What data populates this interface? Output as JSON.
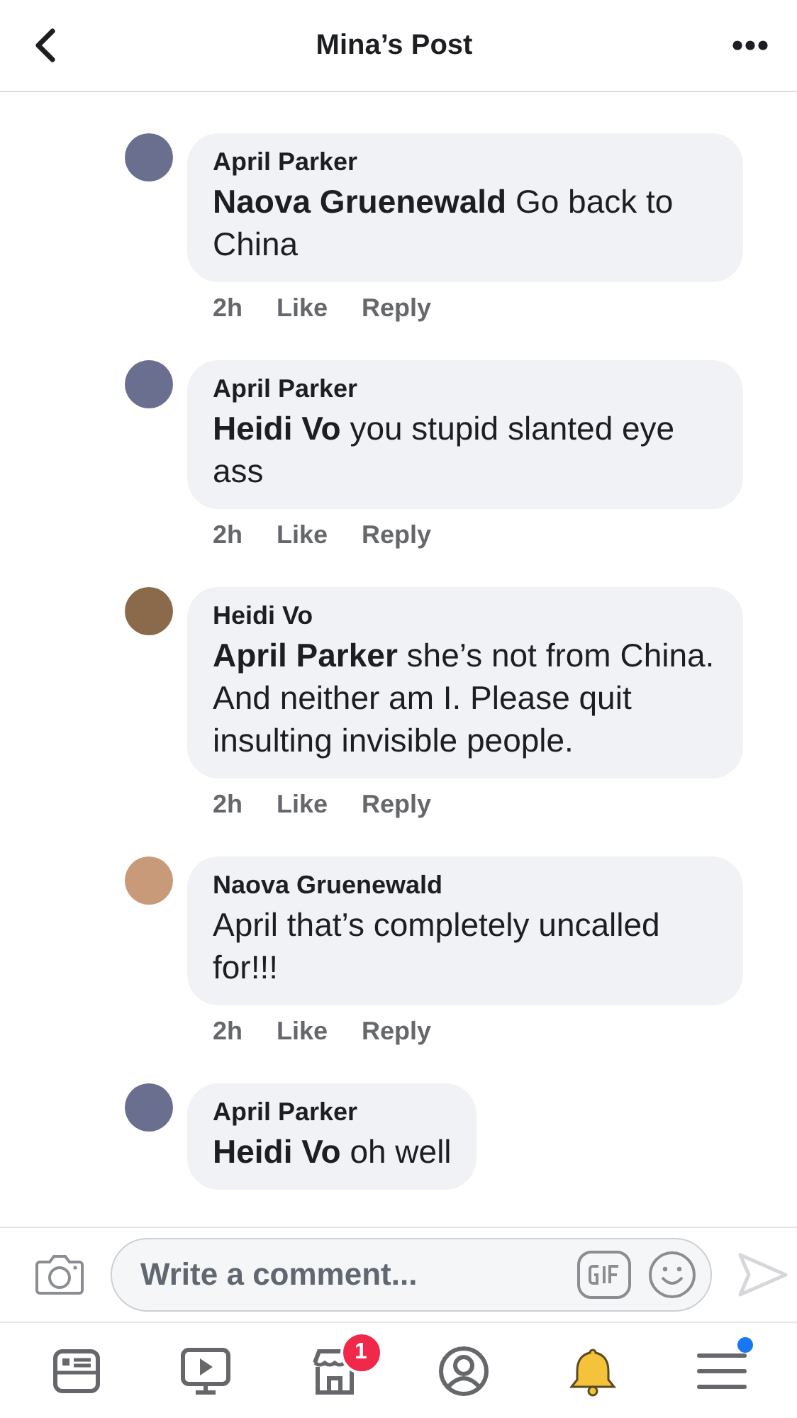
{
  "header": {
    "title": "Mina’s Post"
  },
  "comments": [
    {
      "author": "April Parker",
      "text": "**Naova Gruenewald** Go back to China",
      "time": "2h",
      "like": "Like",
      "reply": "Reply"
    },
    {
      "author": "April Parker",
      "text": "**Heidi Vo** you stupid slanted eye ass",
      "time": "2h",
      "like": "Like",
      "reply": "Reply"
    },
    {
      "author": "Heidi Vo",
      "text": "**April Parker** she’s not from China. And neither am I. Please quit insulting invisible people.",
      "time": "2h",
      "like": "Like",
      "reply": "Reply"
    },
    {
      "author": "Naova Gruenewald",
      "text": "April that’s completely uncalled for!!!",
      "time": "2h",
      "like": "Like",
      "reply": "Reply"
    },
    {
      "author": "April Parker",
      "text": "**Heidi Vo** oh well"
    }
  ],
  "composer": {
    "placeholder": "Write a comment..."
  },
  "nav": [
    {
      "kind": "feed"
    },
    {
      "kind": "video"
    },
    {
      "kind": "shop",
      "badge": "1"
    },
    {
      "kind": "profile"
    },
    {
      "kind": "bell"
    },
    {
      "kind": "menu",
      "dot": true
    }
  ]
}
